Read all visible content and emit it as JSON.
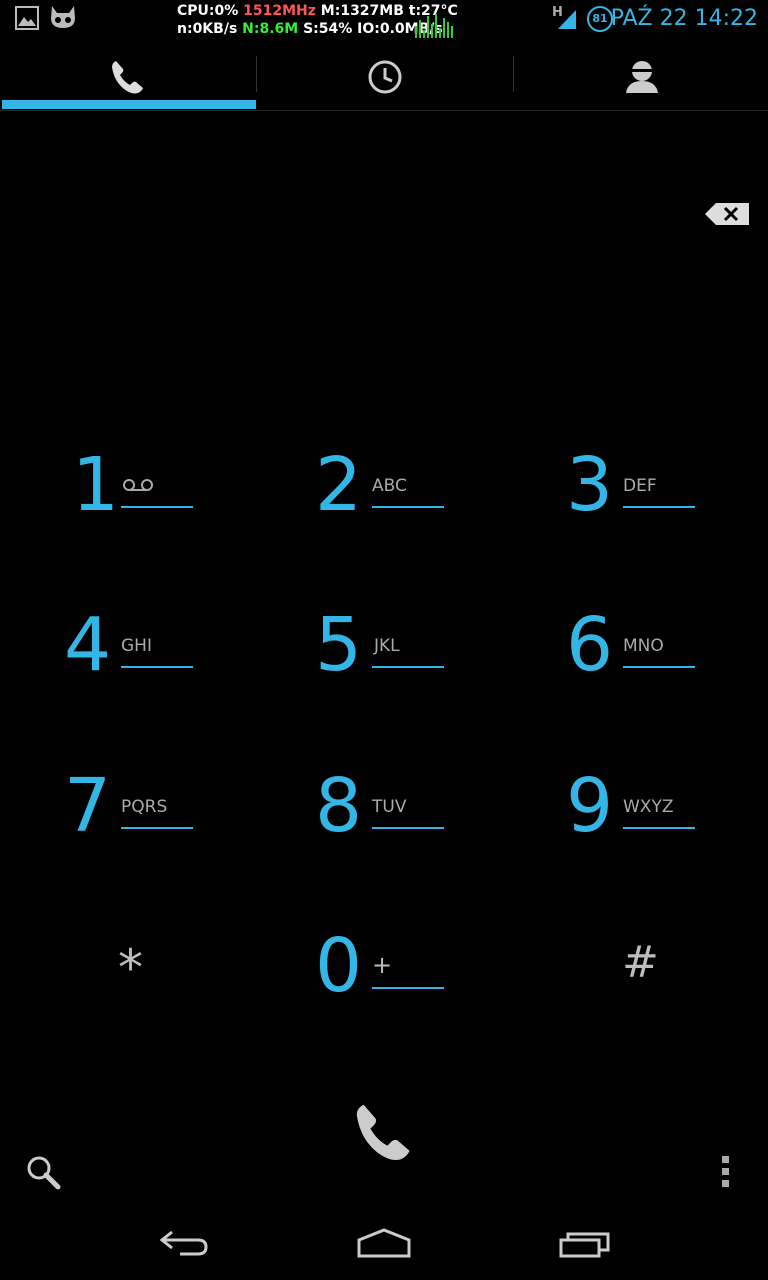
{
  "status_bar": {
    "stats_line1": {
      "cpu": "CPU:0%",
      "freq": "1512MHz",
      "mem": "M:1327MB t:27°C"
    },
    "stats_line2": {
      "net_in": "n:0KB/s",
      "net": "N:8.6M",
      "rest": "S:54% IO:0.0MB/s"
    },
    "network_type": "H",
    "battery": "81",
    "datetime": "PAŹ 22 14:22",
    "icons": [
      "gallery-notification-icon",
      "cyanogenmod-notification-icon",
      "signal-icon",
      "battery-icon"
    ]
  },
  "tabs": [
    {
      "icon": "phone-icon",
      "active": true
    },
    {
      "icon": "clock-icon",
      "active": false
    },
    {
      "icon": "contacts-icon",
      "active": false
    }
  ],
  "dialpad": {
    "keys": [
      {
        "digit": "1",
        "letters": "",
        "icon": "voicemail-icon"
      },
      {
        "digit": "2",
        "letters": "ABC"
      },
      {
        "digit": "3",
        "letters": "DEF"
      },
      {
        "digit": "4",
        "letters": "GHI"
      },
      {
        "digit": "5",
        "letters": "JKL"
      },
      {
        "digit": "6",
        "letters": "MNO"
      },
      {
        "digit": "7",
        "letters": "PQRS"
      },
      {
        "digit": "8",
        "letters": "TUV"
      },
      {
        "digit": "9",
        "letters": "WXYZ"
      },
      {
        "digit": "*",
        "letters": ""
      },
      {
        "digit": "0",
        "letters": "+"
      },
      {
        "digit": "#",
        "letters": ""
      }
    ]
  },
  "colors": {
    "accent": "#33b5e5",
    "letters": "#aaaaaa",
    "background": "#000000"
  }
}
